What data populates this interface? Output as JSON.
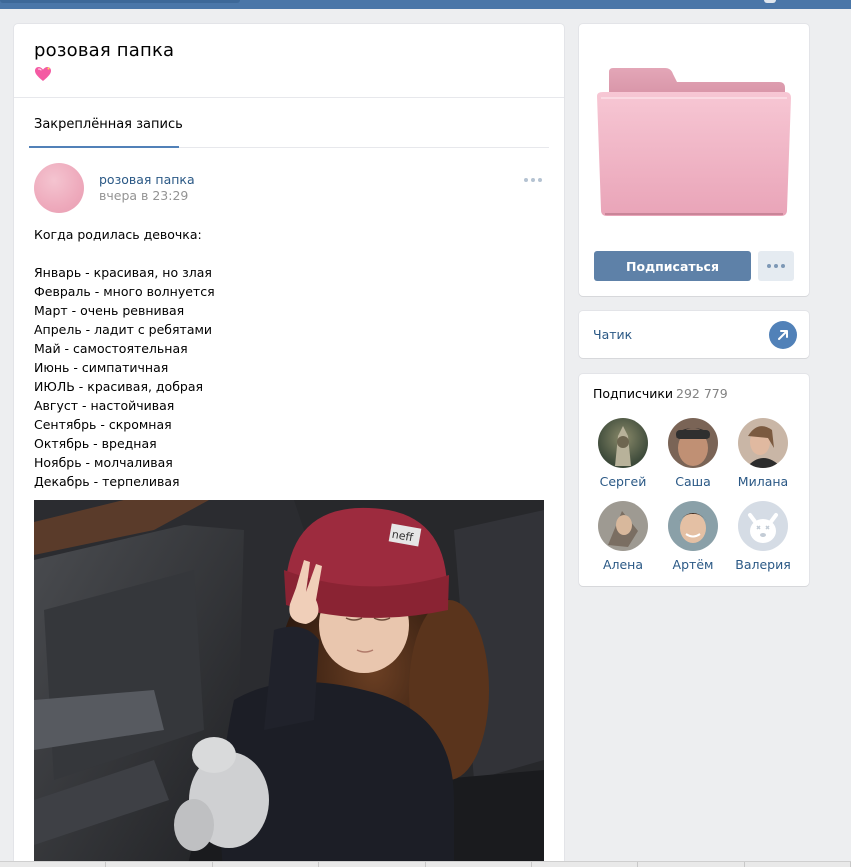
{
  "group": {
    "name": "розовая папка",
    "status_icon": "pink-heart-icon"
  },
  "tabs": {
    "pinned_label": "Закреплённая запись"
  },
  "post": {
    "author": "розовая папка",
    "time": "вчера в 23:29",
    "lines": [
      "Когда родилась девочка:",
      "",
      "Январь - красивая, но злая",
      "Февраль - много волнуется",
      "Март - очень ревнивая",
      "Апрель - ладит с ребятами",
      "Май - самостоятельная",
      "Июнь - симпатичная",
      "ИЮЛЬ - красивая, добрая",
      "Август - настойчивая",
      "Сентябрь - скромная",
      "Октябрь - вредная",
      "Ноябрь - молчаливая",
      "Декабрь - терпеливая"
    ],
    "photo_hat_text": "neff"
  },
  "sidebar": {
    "subscribe_label": "Подписаться",
    "chat_label": "Чатик",
    "members_title": "Подписчики",
    "members_count": "292 779",
    "members": [
      {
        "name": "Сергей"
      },
      {
        "name": "Саша"
      },
      {
        "name": "Милана"
      },
      {
        "name": "Алена"
      },
      {
        "name": "Артём"
      },
      {
        "name": "Валерия"
      }
    ]
  },
  "colors": {
    "accent": "#5181b8",
    "link": "#2a5885",
    "header": "#4a76a8",
    "button": "#5e81a8",
    "folder_pink": "#f2b8c8"
  }
}
